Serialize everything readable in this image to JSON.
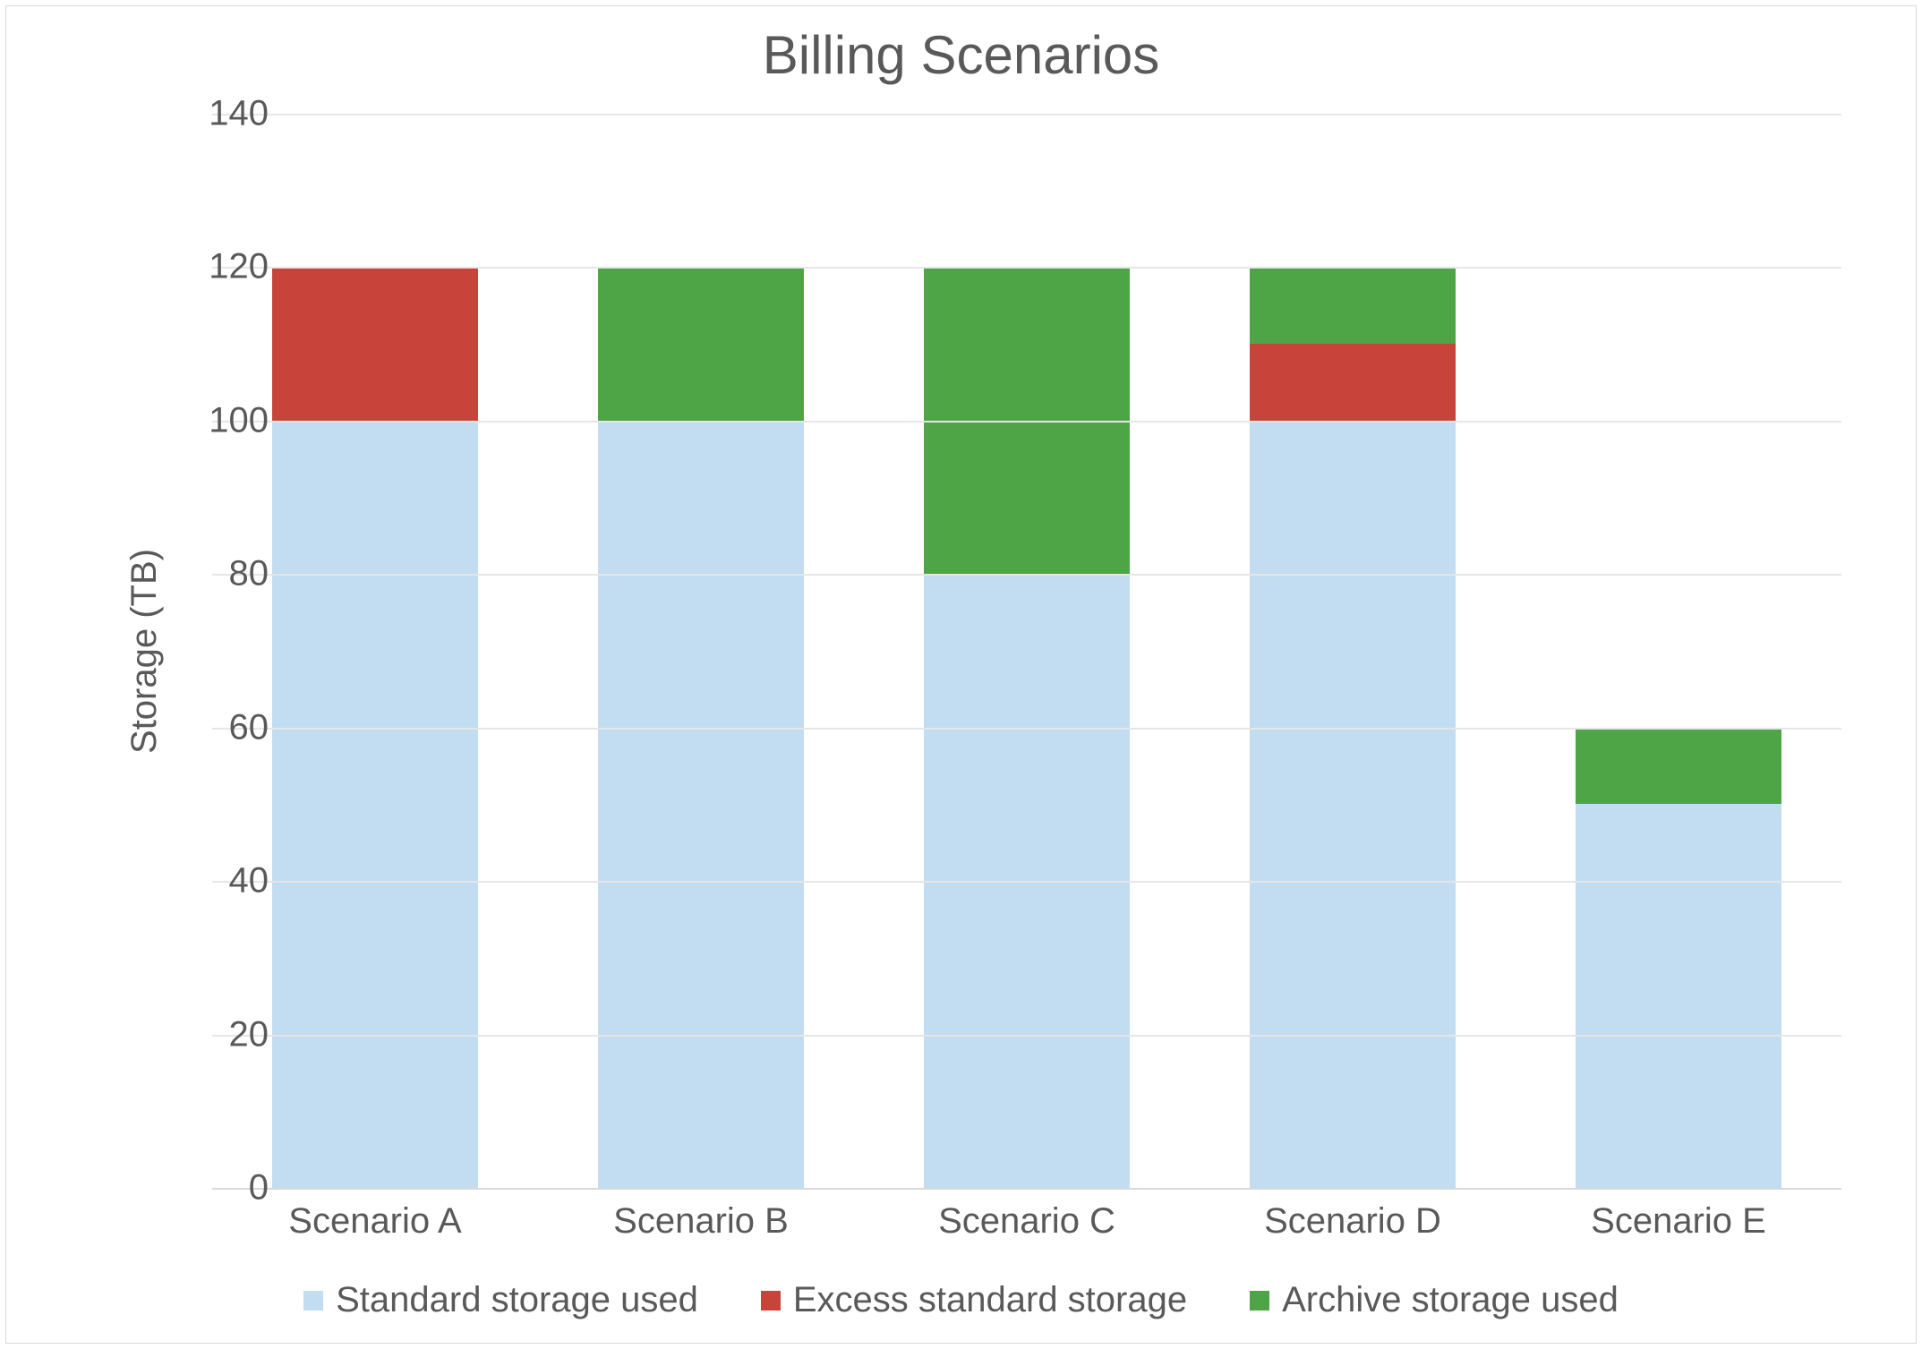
{
  "chart_data": {
    "type": "bar",
    "stacked": true,
    "title": "Billing Scenarios",
    "xlabel": "",
    "ylabel": "Storage (TB)",
    "ylim": [
      0,
      140
    ],
    "ytick_step": 20,
    "categories": [
      "Scenario A",
      "Scenario B",
      "Scenario C",
      "Scenario D",
      "Scenario E"
    ],
    "series": [
      {
        "name": "Standard storage used",
        "color": "#c2dcf2",
        "values": [
          100,
          100,
          80,
          100,
          50
        ]
      },
      {
        "name": "Excess standard storage",
        "color": "#c8443a",
        "values": [
          20,
          0,
          0,
          10,
          0
        ]
      },
      {
        "name": "Archive storage used",
        "color": "#4ea546",
        "values": [
          0,
          20,
          40,
          10,
          10
        ]
      }
    ],
    "legend_position": "bottom",
    "grid": true
  }
}
